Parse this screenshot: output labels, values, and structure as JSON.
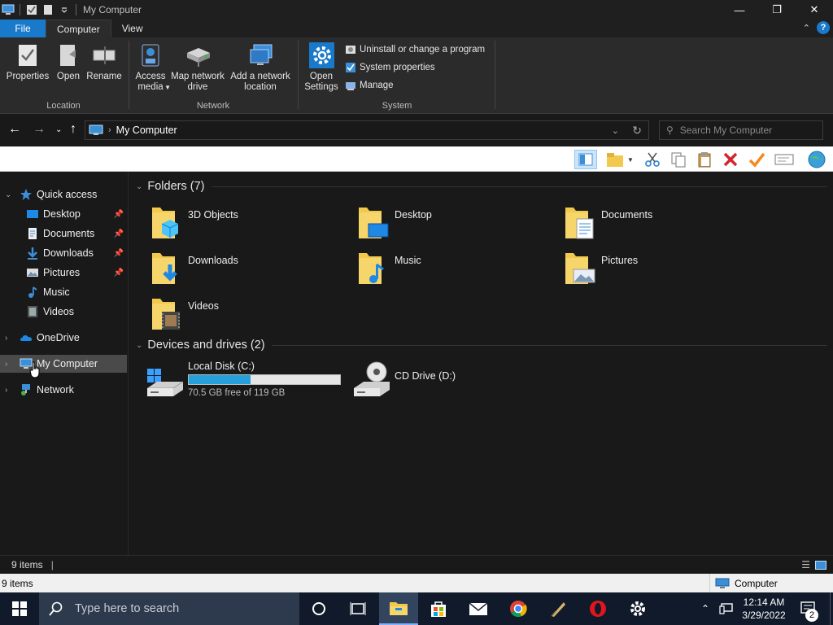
{
  "window": {
    "title": "My Computer"
  },
  "tabs": [
    {
      "label": "File"
    },
    {
      "label": "Computer"
    },
    {
      "label": "View"
    }
  ],
  "ribbon": {
    "location": {
      "label": "Location",
      "properties": "Properties",
      "open": "Open",
      "rename": "Rename"
    },
    "network": {
      "label": "Network",
      "access_media": "Access media",
      "map_drive": "Map network drive",
      "add_location": "Add a network location"
    },
    "system": {
      "label": "System",
      "open_settings": "Open Settings",
      "uninstall": "Uninstall or change a program",
      "sys_props": "System properties",
      "manage": "Manage"
    }
  },
  "address": {
    "path": "My Computer",
    "search_placeholder": "Search My Computer"
  },
  "sidebar": {
    "quick_access": "Quick access",
    "items": [
      {
        "label": "Desktop",
        "pinned": true
      },
      {
        "label": "Documents",
        "pinned": true
      },
      {
        "label": "Downloads",
        "pinned": true
      },
      {
        "label": "Pictures",
        "pinned": true
      },
      {
        "label": "Music",
        "pinned": false
      },
      {
        "label": "Videos",
        "pinned": false
      }
    ],
    "onedrive": "OneDrive",
    "mycomputer": "My Computer",
    "network": "Network"
  },
  "content": {
    "folders_header": "Folders (7)",
    "folders": [
      {
        "name": "3D Objects"
      },
      {
        "name": "Desktop"
      },
      {
        "name": "Documents"
      },
      {
        "name": "Downloads"
      },
      {
        "name": "Music"
      },
      {
        "name": "Pictures"
      },
      {
        "name": "Videos"
      }
    ],
    "drives_header": "Devices and drives (2)",
    "drives": [
      {
        "name": "Local Disk (C:)",
        "free": "70.5 GB free of 119 GB",
        "used_fraction": 0.408
      },
      {
        "name": "CD Drive (D:)"
      }
    ]
  },
  "status": {
    "items": "9 items",
    "items2": "9 items",
    "location": "Computer"
  },
  "taskbar": {
    "search_placeholder": "Type here to search",
    "time": "12:14 AM",
    "date": "3/29/2022",
    "notifications": "2"
  },
  "colors": {
    "accent": "#1979ca",
    "drive_bar": "#26a0da",
    "folder": "#f2c94c"
  }
}
